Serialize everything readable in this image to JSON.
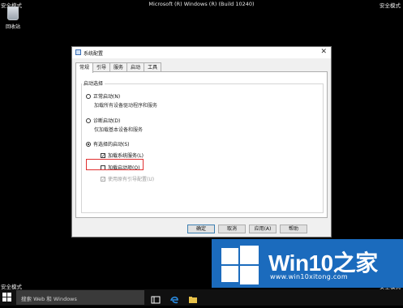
{
  "desktop": {
    "safe_mode_label": "安全模式",
    "window_title": "Microsoft (R) Windows (R) (Build 10240)",
    "recycle_bin_label": "回收站"
  },
  "dialog": {
    "title": "系统配置",
    "tabs": [
      "常规",
      "引导",
      "服务",
      "启动",
      "工具"
    ],
    "group_label": "启动选择",
    "normal_startup": "正常启动(N)",
    "normal_desc": "加载所有设备驱动程序和服务",
    "diagnostic_startup": "诊断启动(D)",
    "diagnostic_desc": "仅加载基本设备和服务",
    "selective_startup": "有选择的启动(S)",
    "load_system_services": "加载系统服务(L)",
    "load_startup_items": "加载启动项(O)",
    "use_original_boot": "使用原有引导配置(U)",
    "buttons": {
      "ok": "确定",
      "cancel": "取消",
      "apply": "应用(A)",
      "help": "帮助"
    }
  },
  "taskbar": {
    "search_placeholder": "搜索 Web 和 Windows"
  },
  "watermark": {
    "brand": "Win10之家",
    "url": "www.win10xitong.com"
  }
}
